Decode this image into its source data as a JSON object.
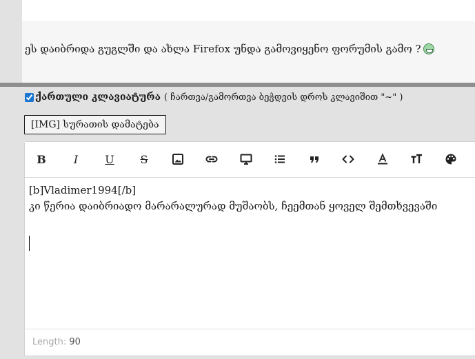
{
  "post": {
    "text": "ეს დაიბრიდა გუგლში და ახლა Firefox უნდა გამოვიყენო ფორუმის გამო ?",
    "emoji_icon": "grin-emoji-icon"
  },
  "reply": {
    "keyboard_label": "ქართული კლავიატურა",
    "keyboard_hint": "( ჩართვა/გამორთვა ბეჭდვის დროს კლავიშით \"~\" )",
    "keyboard_checked": true,
    "img_button_label": "[IMG] სურათის დამატება"
  },
  "toolbar": [
    {
      "name": "bold-button",
      "icon": "bold-icon",
      "label": "B"
    },
    {
      "name": "italic-button",
      "icon": "italic-icon",
      "label": "I"
    },
    {
      "name": "underline-button",
      "icon": "underline-icon",
      "label": "U"
    },
    {
      "name": "strikethrough-button",
      "icon": "strikethrough-icon",
      "label": "S"
    },
    {
      "name": "image-button",
      "icon": "image-icon"
    },
    {
      "name": "link-button",
      "icon": "link-icon"
    },
    {
      "name": "video-button",
      "icon": "monitor-icon"
    },
    {
      "name": "list-button",
      "icon": "list-icon"
    },
    {
      "name": "quote-button",
      "icon": "quote-icon"
    },
    {
      "name": "code-button",
      "icon": "code-icon"
    },
    {
      "name": "text-color-button",
      "icon": "text-color-icon"
    },
    {
      "name": "font-size-button",
      "icon": "font-size-icon"
    },
    {
      "name": "palette-button",
      "icon": "palette-icon"
    }
  ],
  "editor": {
    "line1": "[b]Vladimer1994[/b]",
    "line2": "კი წერია დაიბრიადო მარარალურად მუშაობს, ჩეემთან ყოველ შემთხვევაში"
  },
  "footer": {
    "length_label": "Length:",
    "length_value": "90"
  }
}
